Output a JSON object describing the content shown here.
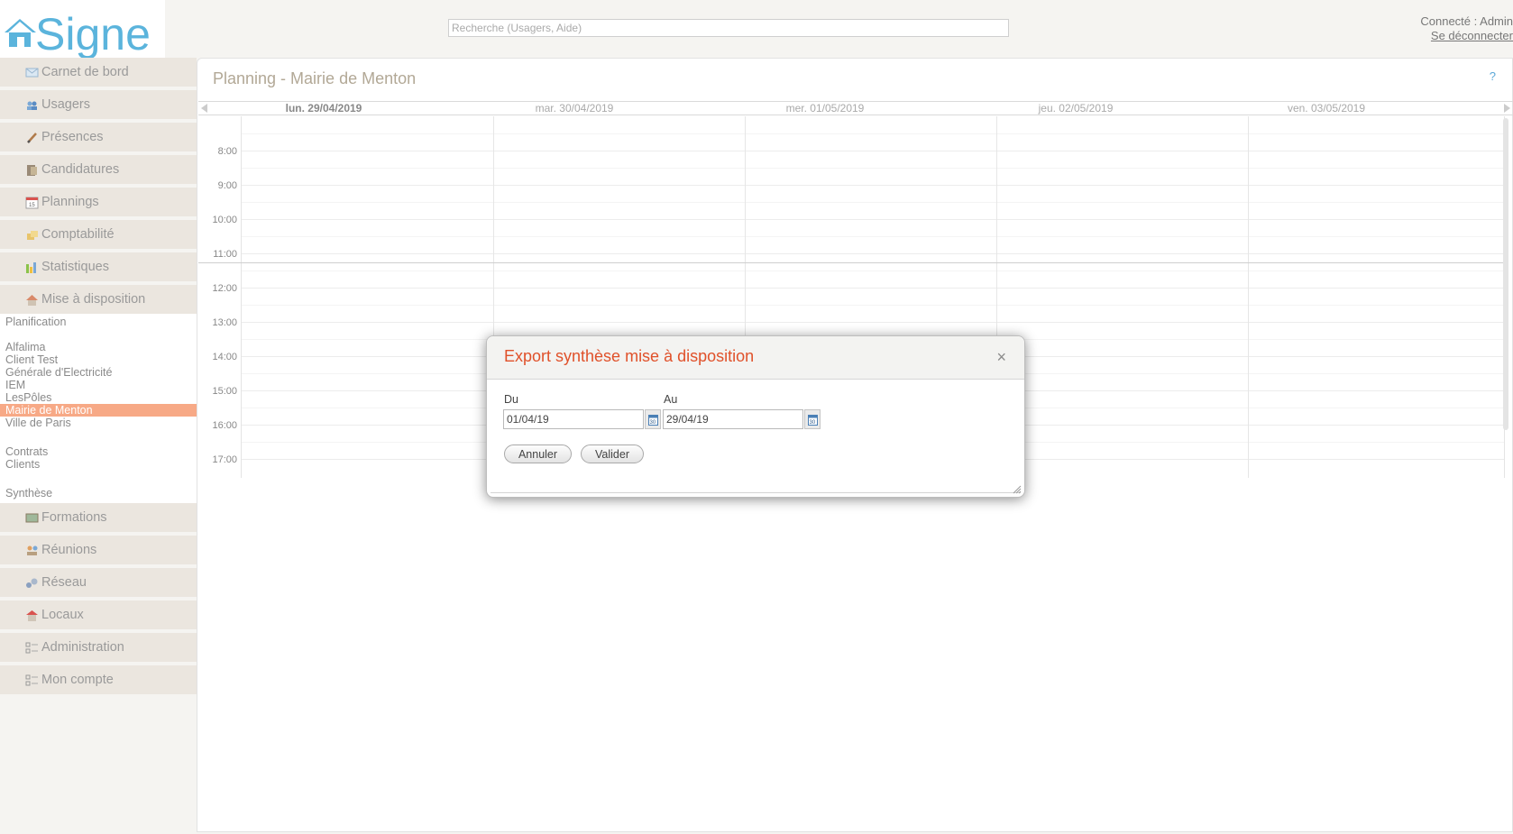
{
  "logo": {
    "text": "Signe"
  },
  "search": {
    "placeholder": "Recherche (Usagers, Aide)"
  },
  "user": {
    "connected": "Connecté : Admin",
    "logout": "Se déconnecter"
  },
  "sidebar": {
    "items_top": [
      {
        "label": "Carnet de bord",
        "icon": "envelope-icon"
      },
      {
        "label": "Usagers",
        "icon": "users-icon"
      },
      {
        "label": "Présences",
        "icon": "pencil-icon"
      },
      {
        "label": "Candidatures",
        "icon": "folder-icon"
      },
      {
        "label": "Plannings",
        "icon": "calendar-icon"
      },
      {
        "label": "Comptabilité",
        "icon": "coins-icon"
      },
      {
        "label": "Statistiques",
        "icon": "bar-chart-icon"
      },
      {
        "label": "Mise à disposition",
        "icon": "house-icon"
      }
    ],
    "submenu": {
      "planification": "Planification",
      "clients": [
        "Alfalima",
        "Client Test",
        "Générale d'Electricité",
        "IEM",
        "LesPôles",
        "Mairie de Menton",
        "Ville de Paris"
      ],
      "selected": "Mairie de Menton",
      "contrats": "Contrats",
      "clients_link": "Clients",
      "synthese": "Synthèse"
    },
    "items_bottom": [
      {
        "label": "Formations",
        "icon": "blackboard-icon"
      },
      {
        "label": "Réunions",
        "icon": "meeting-icon"
      },
      {
        "label": "Réseau",
        "icon": "network-icon"
      },
      {
        "label": "Locaux",
        "icon": "building-icon"
      },
      {
        "label": "Administration",
        "icon": "admin-icon"
      },
      {
        "label": "Mon compte",
        "icon": "account-icon"
      }
    ]
  },
  "main": {
    "title": "Planning - Mairie de Menton",
    "help": "?",
    "days": [
      "lun. 29/04/2019",
      "mar. 30/04/2019",
      "mer. 01/05/2019",
      "jeu. 02/05/2019",
      "ven. 03/05/2019"
    ],
    "times": [
      "8:00",
      "9:00",
      "10:00",
      "11:00",
      "12:00",
      "13:00",
      "14:00",
      "15:00",
      "16:00",
      "17:00"
    ]
  },
  "modal": {
    "title": "Export synthèse mise à disposition",
    "close": "×",
    "du_label": "Du",
    "du_value": "01/04/19",
    "au_label": "Au",
    "au_value": "29/04/19",
    "cancel": "Annuler",
    "submit": "Valider"
  },
  "colors": {
    "accent": "#e0512a",
    "selected": "#f7a986",
    "logo": "#5bb4dc",
    "menu_bg": "#ebe6df"
  }
}
